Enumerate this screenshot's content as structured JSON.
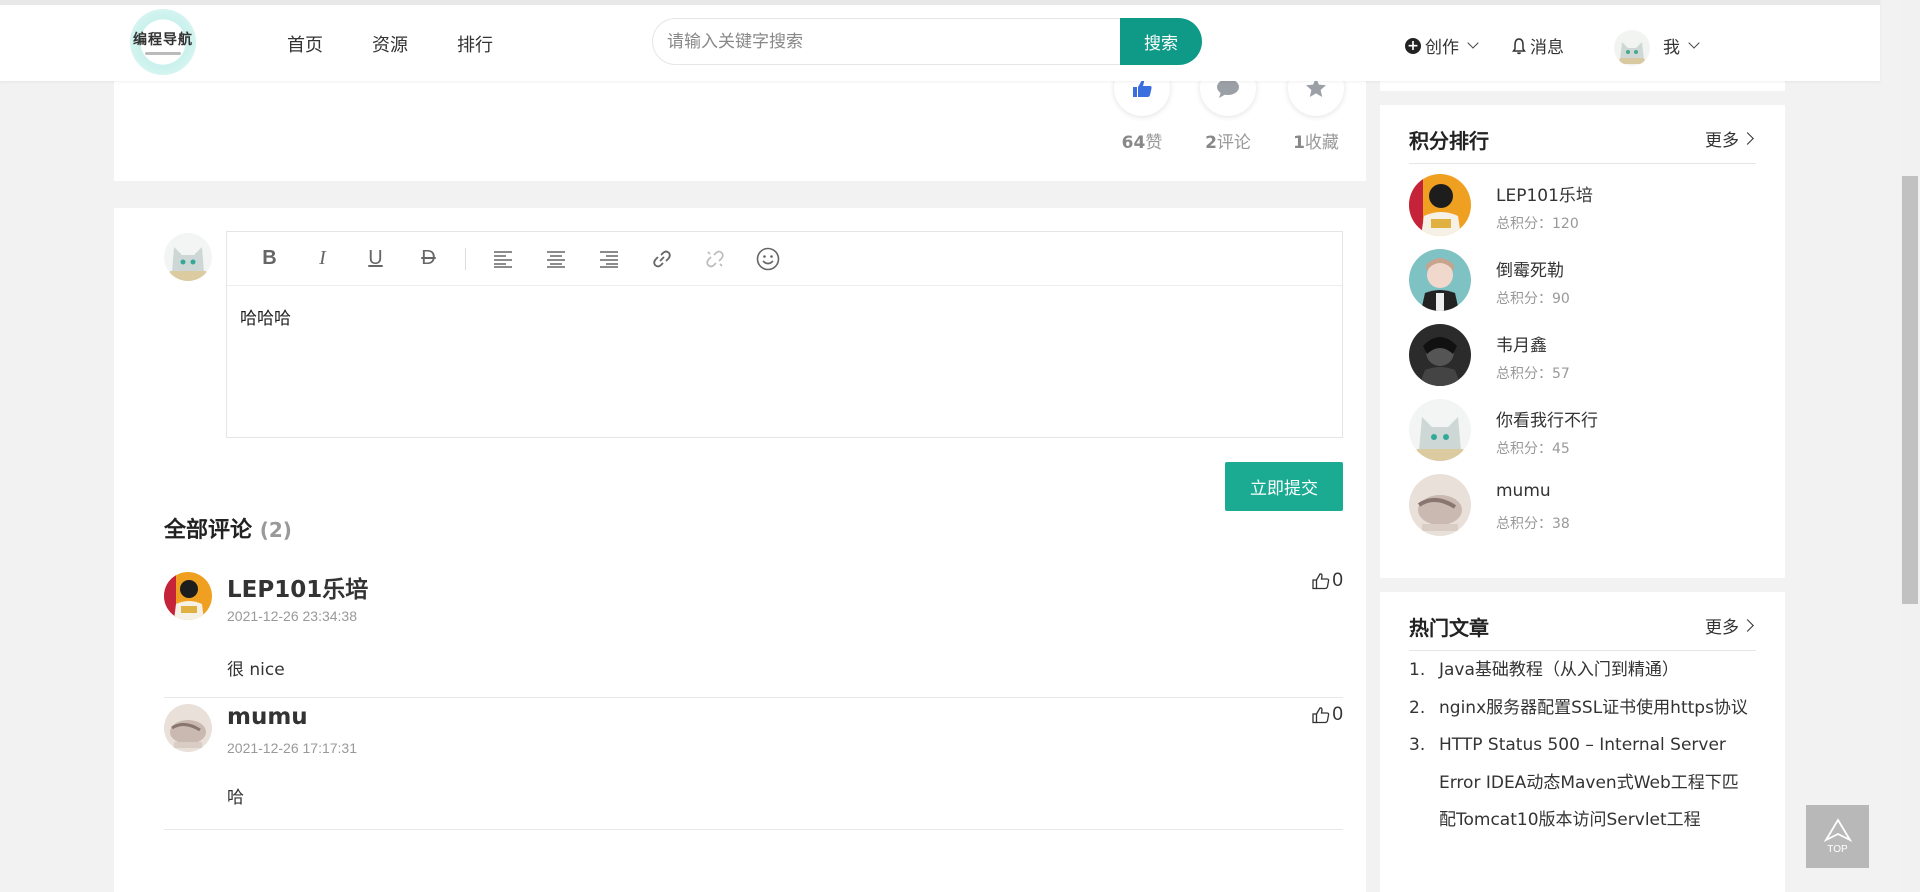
{
  "header": {
    "logo_text": "编程导航",
    "nav": [
      "首页",
      "资源",
      "排行"
    ],
    "search_placeholder": "请输入关键字搜索",
    "search_button": "搜索",
    "create": "创作",
    "messages": "消息",
    "me": "我"
  },
  "article_actions": {
    "likes_count": "64",
    "likes_label": "赞",
    "comments_count": "2",
    "comments_label": "评论",
    "favorites_count": "1",
    "favorites_label": "收藏"
  },
  "editor": {
    "content": "哈哈哈",
    "submit_label": "立即提交"
  },
  "comments_section": {
    "title": "全部评论",
    "count": "(2)",
    "items": [
      {
        "name": "LEP101乐培",
        "time": "2021-12-26 23:34:38",
        "text": "很 nice",
        "likes": "0"
      },
      {
        "name": "mumu",
        "time": "2021-12-26 17:17:31",
        "text": "哈",
        "likes": "0"
      }
    ]
  },
  "ranking": {
    "title": "积分排行",
    "more": "更多",
    "items": [
      {
        "name": "LEP101乐培",
        "score": "总积分：120"
      },
      {
        "name": "倒霉死勒",
        "score": "总积分：90"
      },
      {
        "name": "韦月鑫",
        "score": "总积分：57"
      },
      {
        "name": "你看我行不行",
        "score": "总积分：45"
      },
      {
        "name": "mumu",
        "score": "总积分：38"
      }
    ]
  },
  "hot_articles": {
    "title": "热门文章",
    "more": "更多",
    "items": [
      {
        "num": "1.",
        "title": "Java基础教程（从入门到精通）"
      },
      {
        "num": "2.",
        "title": "nginx服务器配置SSL证书使用https协议"
      },
      {
        "num": "3.",
        "title": "HTTP Status 500 – Internal Server Error IDEA动态Maven式Web工程下匹配Tomcat10版本访问Servlet工程"
      }
    ]
  },
  "back_to_top": "TOP",
  "colors": {
    "accent": "#0f9a88",
    "submit": "#1bab93",
    "like_blue": "#3b6fe0"
  }
}
